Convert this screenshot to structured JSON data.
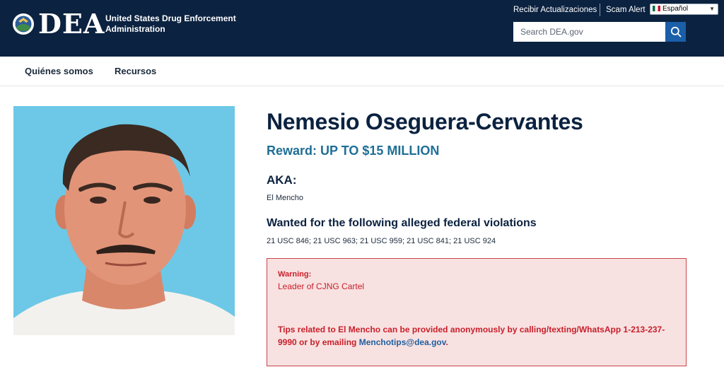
{
  "header": {
    "logo_text": "DEA",
    "agency_name": "United States Drug Enforcement Administration",
    "links": {
      "updates": "Recibir Actualizaciones",
      "scam_alert": "Scam Alert"
    },
    "language": {
      "selected": "Español"
    },
    "search": {
      "placeholder": "Search DEA.gov"
    },
    "colors": {
      "background": "#0b2240",
      "search_button": "#1a5fa8"
    }
  },
  "nav": {
    "items": [
      {
        "label": "Quiénes somos"
      },
      {
        "label": "Recursos"
      }
    ]
  },
  "fugitive": {
    "name": "Nemesio Oseguera-Cervantes",
    "reward": "Reward: UP TO $15 MILLION",
    "aka_label": "AKA:",
    "aka": "El Mencho",
    "violations_label": "Wanted for the following alleged federal violations",
    "violations": "21 USC 846; 21 USC 963; 21 USC 959; 21 USC 841; 21 USC 924",
    "warning_label": "Warning:",
    "warning": "Leader of CJNG Cartel",
    "tips_text": "Tips related to El Mencho can be provided anonymously by calling/texting/WhatsApp 1-213-237-9990 or by emailing ",
    "tips_email": "Menchotips@dea.gov",
    "tips_end": "."
  }
}
